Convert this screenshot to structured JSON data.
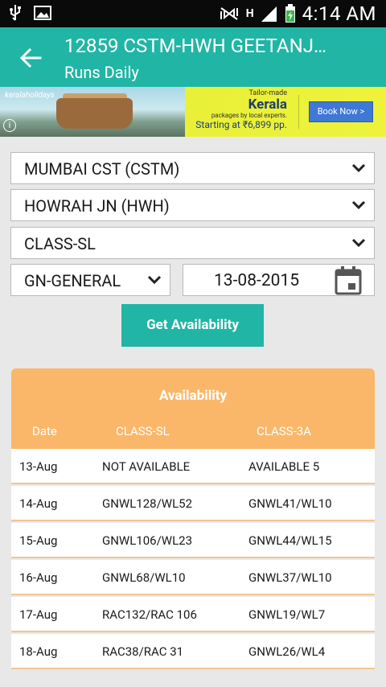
{
  "status_bar": {
    "time": "4:14 AM",
    "network_label": "H"
  },
  "app_bar": {
    "title": "12859 CSTM-HWH GEETANJ…",
    "subtitle": "Runs Daily"
  },
  "ad": {
    "brand_text": "keralaholidays",
    "tagline": "Tailor-made",
    "headline": "Kerala",
    "subline": "packages by local experts.",
    "price_text": "Starting at ₹6,899 pp.",
    "button_label": "Book Now >",
    "info_glyph": "i"
  },
  "form": {
    "from_station": "MUMBAI CST (CSTM)",
    "to_station": "HOWRAH JN (HWH)",
    "travel_class": "CLASS-SL",
    "quota": "GN-GENERAL",
    "date": "13-08-2015",
    "submit_label": "Get Availability"
  },
  "availability": {
    "caption": "Availability",
    "headers": [
      "Date",
      "CLASS-SL",
      "CLASS-3A"
    ],
    "rows": [
      [
        "13-Aug",
        "NOT AVAILABLE",
        "AVAILABLE 5"
      ],
      [
        "14-Aug",
        "GNWL128/WL52",
        "GNWL41/WL10"
      ],
      [
        "15-Aug",
        "GNWL106/WL23",
        "GNWL44/WL15"
      ],
      [
        "16-Aug",
        "GNWL68/WL10",
        "GNWL37/WL10"
      ],
      [
        "17-Aug",
        "RAC132/RAC 106",
        "GNWL19/WL7"
      ],
      [
        "18-Aug",
        "RAC38/RAC 31",
        "GNWL26/WL4"
      ]
    ]
  },
  "colors": {
    "primary": "#21b5a5",
    "table_header": "#fbb769",
    "status_bar": "#0a0a0a",
    "background": "#e8e8e8"
  },
  "icons": {
    "back": "arrow-left-icon",
    "dropdown": "chevron-down-icon",
    "calendar": "calendar-icon"
  }
}
